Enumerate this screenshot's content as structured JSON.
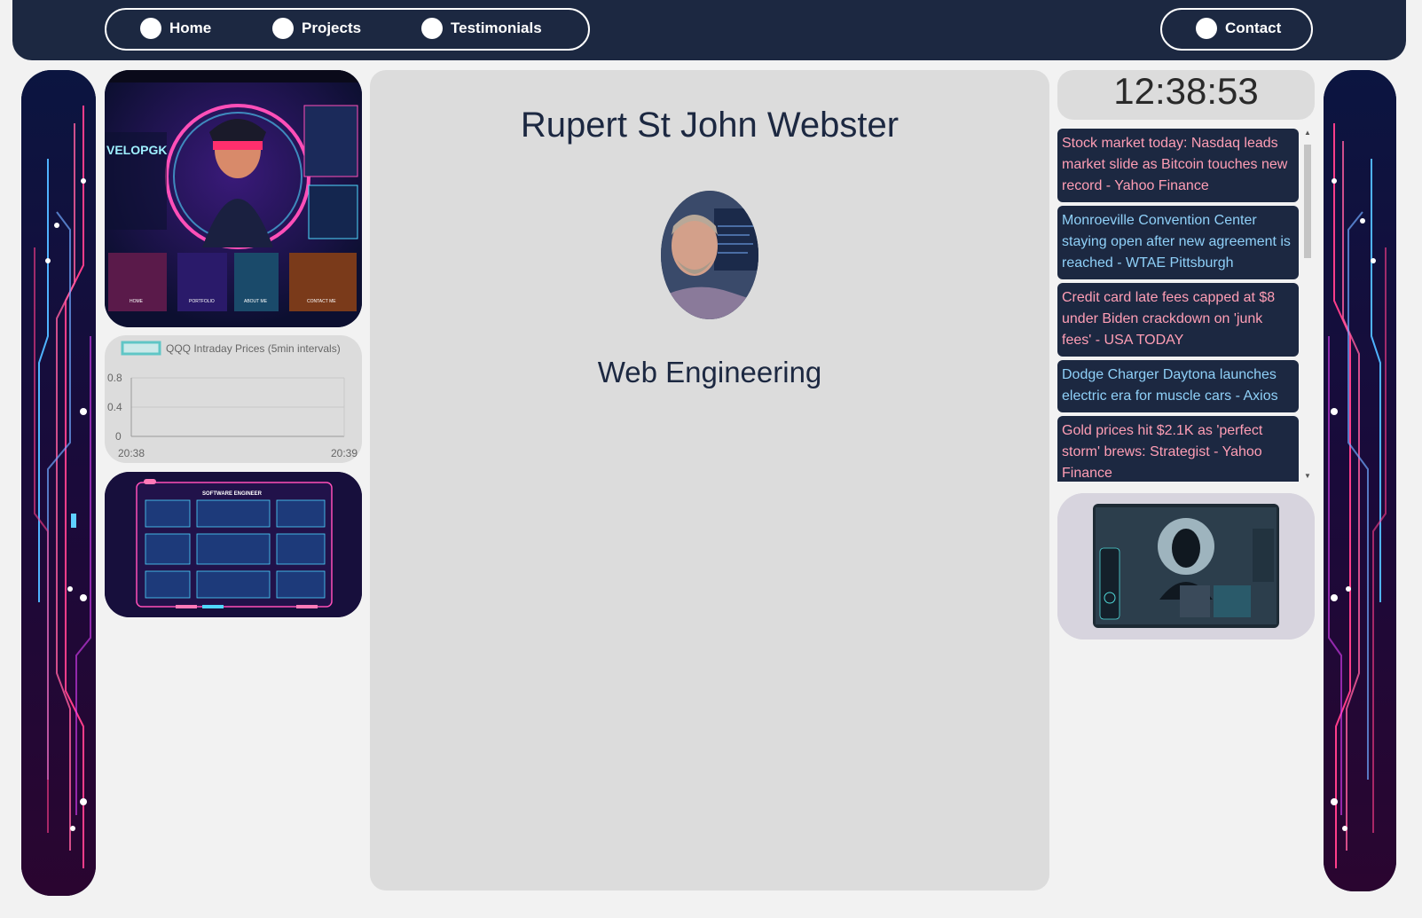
{
  "nav": {
    "items": [
      {
        "label": "Home"
      },
      {
        "label": "Projects"
      },
      {
        "label": "Testimonials"
      }
    ],
    "contact_label": "Contact"
  },
  "left_cards": {
    "top_image_text": "VELOPGK",
    "top_image_tabs": [
      "HOME",
      "PORTFOLIO",
      "ABOUT ME",
      "CONTACT ME"
    ],
    "bottom_image_title": "SOFTWARE ENGINEER"
  },
  "chart_data": {
    "type": "line",
    "title": "QQQ Intraday Prices (5min intervals)",
    "series": [
      {
        "name": "QQQ Intraday Prices (5min intervals)",
        "values": []
      }
    ],
    "x_ticks": [
      "20:38",
      "20:39"
    ],
    "y_ticks": [
      "0.8",
      "0.4",
      "0"
    ],
    "ylim": [
      0,
      1
    ],
    "legend_color": "#5fc6c6"
  },
  "profile": {
    "name": "Rupert St John Webster",
    "role": "Web Engineering"
  },
  "clock": {
    "time": "12:38:53"
  },
  "news": [
    {
      "text": "Stock market today: Nasdaq leads market slide as Bitcoin touches new record - Yahoo Finance",
      "color": "pink"
    },
    {
      "text": "Monroeville Convention Center staying open after new agreement is reached - WTAE Pittsburgh",
      "color": "blue"
    },
    {
      "text": "Credit card late fees capped at $8 under Biden crackdown on 'junk fees' - USA TODAY",
      "color": "pink"
    },
    {
      "text": "Dodge Charger Daytona launches electric era for muscle cars - Axios",
      "color": "blue"
    },
    {
      "text": "Gold prices hit $2.1K as 'perfect storm' brews: Strategist - Yahoo Finance",
      "color": "pink"
    }
  ],
  "colors": {
    "navy": "#1c2841",
    "panel": "#dcdcdc",
    "news_pink": "#ff9eb5",
    "news_blue": "#8fd0f8"
  }
}
